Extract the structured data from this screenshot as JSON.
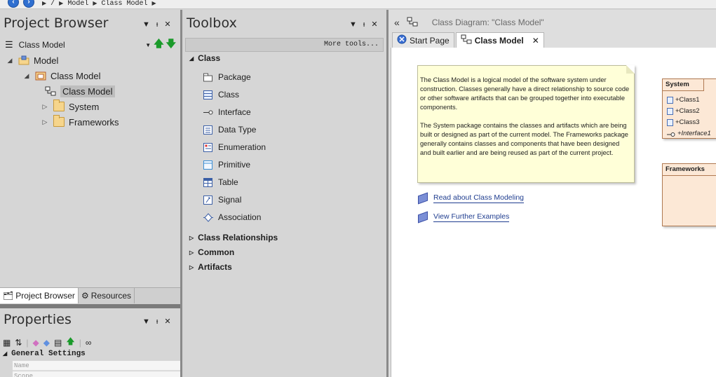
{
  "nav": {
    "back_icon": "back-arrow-icon",
    "forward_icon": "forward-arrow-icon",
    "breadcrumbs": [
      "/",
      "Model",
      "Class Model"
    ]
  },
  "project_browser": {
    "title": "Project Browser",
    "current_view": "Class Model",
    "tree": [
      {
        "label": "Model",
        "icon": "model-root-icon",
        "expander": "collapse"
      },
      {
        "label": "Class Model",
        "icon": "package-icon",
        "expander": "collapse"
      },
      {
        "label": "Class Model",
        "icon": "class-diagram-icon",
        "expander": "",
        "selected": true
      },
      {
        "label": "System",
        "icon": "folder-icon",
        "expander": "expand"
      },
      {
        "label": "Frameworks",
        "icon": "folder-icon",
        "expander": "expand"
      }
    ],
    "tabs": [
      {
        "label": "Project Browser",
        "icon": "project-browser-icon",
        "active": true
      },
      {
        "label": "Resources",
        "icon": "resources-icon",
        "active": false
      }
    ]
  },
  "properties": {
    "title": "Properties",
    "section": "General Settings",
    "rows": [
      "Name",
      "Scope"
    ]
  },
  "toolbox": {
    "title": "Toolbox",
    "more_tools": "More tools...",
    "groups": [
      {
        "label": "Class",
        "expanded": true,
        "items": [
          {
            "label": "Package",
            "icon": "package-tool-icon"
          },
          {
            "label": "Class",
            "icon": "class-tool-icon"
          },
          {
            "label": "Interface",
            "icon": "interface-tool-icon"
          },
          {
            "label": "Data Type",
            "icon": "datatype-tool-icon"
          },
          {
            "label": "Enumeration",
            "icon": "enumeration-tool-icon"
          },
          {
            "label": "Primitive",
            "icon": "primitive-tool-icon"
          },
          {
            "label": "Table",
            "icon": "table-tool-icon"
          },
          {
            "label": "Signal",
            "icon": "signal-tool-icon"
          },
          {
            "label": "Association",
            "icon": "association-tool-icon"
          }
        ]
      },
      {
        "label": "Class Relationships",
        "expanded": false
      },
      {
        "label": "Common",
        "expanded": false
      },
      {
        "label": "Artifacts",
        "expanded": false
      }
    ]
  },
  "diagram": {
    "header": "Class Diagram: \"Class Model\"",
    "tabs": [
      {
        "label": "Start Page",
        "icon": "start-page-icon",
        "active": false
      },
      {
        "label": "Class Model",
        "icon": "class-diagram-icon",
        "active": true
      }
    ],
    "note_paragraphs": [
      "The Class Model is a logical model of the software system under construction. Classes generally have a direct relationship to source code or other software artifacts that can be grouped together into executable components.",
      "The System package contains the classes and artifacts which are being built or designed as part of the current model. The Frameworks package generally contains classes and components that have been designed and built earlier and are being reused as part of the current project."
    ],
    "links": [
      "Read about Class Modeling",
      "View Further Examples"
    ],
    "packages": [
      {
        "name": "System",
        "items": [
          {
            "label": "+Class1",
            "kind": "class"
          },
          {
            "label": "+Class2",
            "kind": "class"
          },
          {
            "label": "+Class3",
            "kind": "class"
          },
          {
            "label": "+Interface1",
            "kind": "interface"
          }
        ]
      },
      {
        "name": "Frameworks",
        "items": []
      }
    ]
  },
  "colors": {
    "note_bg": "#ffffd8",
    "package_bg": "#fce8d6",
    "link": "#1f3d8f",
    "panel_bg": "#d6d6d6"
  }
}
